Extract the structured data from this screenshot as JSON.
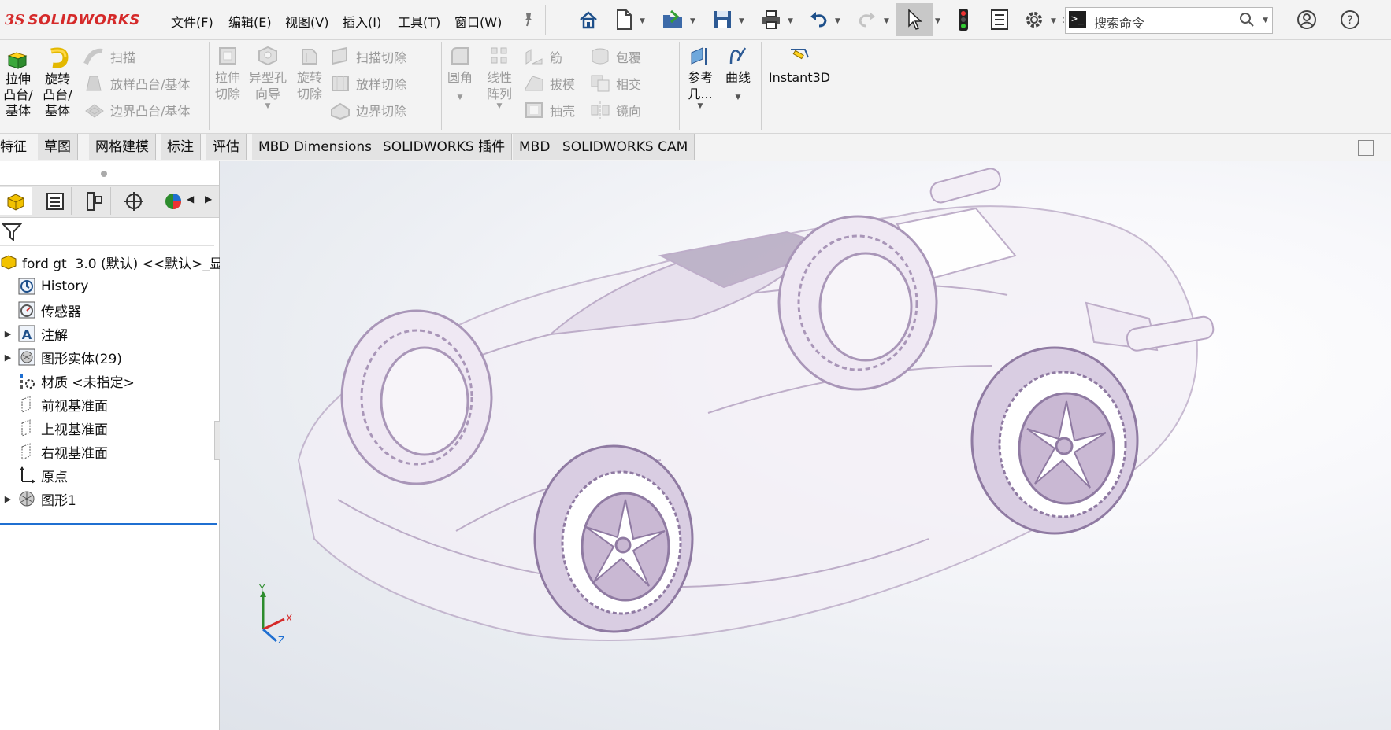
{
  "app": {
    "logo_ds": "3S",
    "logo_solid": "SOLID",
    "logo_works": "WORKS"
  },
  "menu": [
    "文件(F)",
    "编辑(E)",
    "视图(V)",
    "插入(I)",
    "工具(T)",
    "窗口(W)"
  ],
  "search": {
    "placeholder": "搜索命令",
    "cmd_glyph": ">_"
  },
  "command_manager": {
    "extrude_boss": "拉伸\n凸台/\n基体",
    "revolve_boss": "旋转\n凸台/\n基体",
    "sweep": "扫描",
    "loft_boss": "放样凸台/基体",
    "boundary_boss": "边界凸台/基体",
    "extrude_cut": "拉伸\n切除",
    "hole_wizard": "异型孔\n向导",
    "revolve_cut": "旋转\n切除",
    "sweep_cut": "扫描切除",
    "loft_cut": "放样切除",
    "boundary_cut": "边界切除",
    "fillet": "圆角",
    "linear_pattern": "线性\n阵列",
    "rib": "筋",
    "draft": "拔模",
    "shell": "抽壳",
    "wrap": "包覆",
    "intersect": "相交",
    "mirror": "镜向",
    "reference_geometry": "参考\n几...",
    "curves": "曲线",
    "instant3d": "Instant3D"
  },
  "tabs": [
    {
      "label": "特征",
      "active": true
    },
    {
      "label": "草图",
      "active": false
    },
    {
      "label": "网格建模",
      "active": false
    },
    {
      "label": "标注",
      "active": false
    },
    {
      "label": "评估",
      "active": false
    },
    {
      "label": "MBD Dimensions",
      "active": false
    },
    {
      "label": "SOLIDWORKS 插件",
      "active": false
    },
    {
      "label": "MBD",
      "active": false
    },
    {
      "label": "SOLIDWORKS CAM",
      "active": false
    }
  ],
  "tree": {
    "root": "ford gt  3.0 (默认) <<默认>_显",
    "items": [
      {
        "label": "History",
        "icon": "history-icon",
        "expandable": false
      },
      {
        "label": "传感器",
        "icon": "sensor-icon",
        "expandable": false
      },
      {
        "label": "注解",
        "icon": "annotation-icon",
        "expandable": true
      },
      {
        "label": "图形实体(29)",
        "icon": "graphics-body-icon",
        "expandable": true
      },
      {
        "label": "材质 <未指定>",
        "icon": "material-icon",
        "expandable": false
      },
      {
        "label": "前视基准面",
        "icon": "plane-icon",
        "expandable": false
      },
      {
        "label": "上视基准面",
        "icon": "plane-icon",
        "expandable": false
      },
      {
        "label": "右视基准面",
        "icon": "plane-icon",
        "expandable": false
      },
      {
        "label": "原点",
        "icon": "origin-icon",
        "expandable": false
      },
      {
        "label": "图形1",
        "icon": "graphic-icon",
        "expandable": true
      }
    ]
  },
  "triad": {
    "x": "X",
    "y": "Y",
    "z": "Z"
  },
  "colors": {
    "accent": "#1f6fd1",
    "logo_red": "#d52a2a",
    "model_tint": "#c9b8d3",
    "rollback_bar": "#1f6fd1"
  }
}
